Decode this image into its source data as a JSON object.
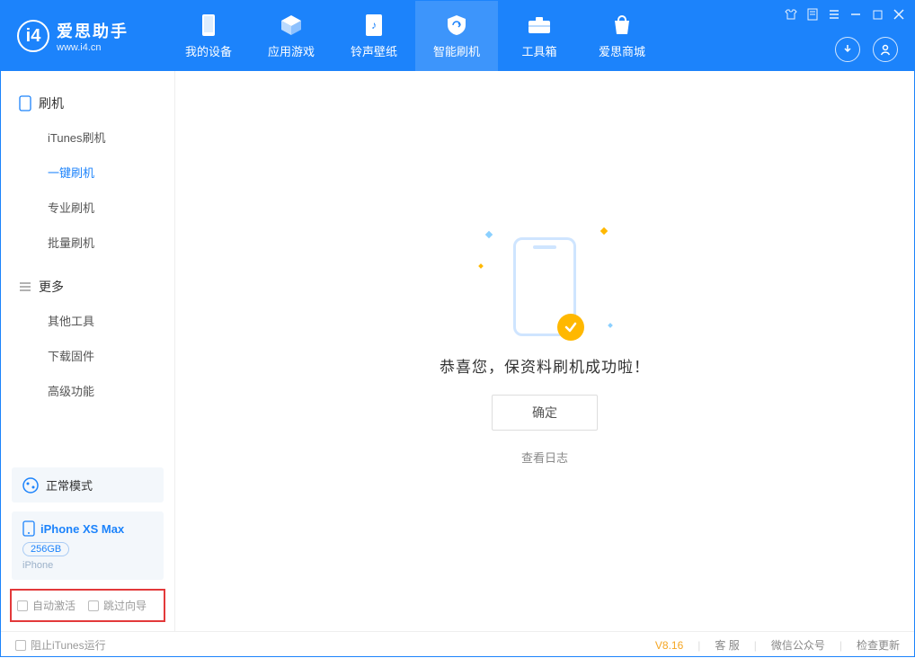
{
  "app": {
    "name_cn": "爱思助手",
    "url": "www.i4.cn"
  },
  "nav": {
    "tabs": [
      {
        "label": "我的设备"
      },
      {
        "label": "应用游戏"
      },
      {
        "label": "铃声壁纸"
      },
      {
        "label": "智能刷机"
      },
      {
        "label": "工具箱"
      },
      {
        "label": "爱思商城"
      }
    ]
  },
  "sidebar": {
    "section1_title": "刷机",
    "section1_items": [
      "iTunes刷机",
      "一键刷机",
      "专业刷机",
      "批量刷机"
    ],
    "section2_title": "更多",
    "section2_items": [
      "其他工具",
      "下载固件",
      "高级功能"
    ],
    "mode_label": "正常模式",
    "device": {
      "name": "iPhone XS Max",
      "capacity": "256GB",
      "type": "iPhone"
    },
    "options": {
      "auto_activate": "自动激活",
      "skip_guide": "跳过向导"
    }
  },
  "main": {
    "success_message": "恭喜您，保资料刷机成功啦！",
    "confirm_label": "确定",
    "view_log_label": "查看日志"
  },
  "status": {
    "block_itunes": "阻止iTunes运行",
    "version": "V8.16",
    "customer_service": "客 服",
    "wechat_public": "微信公众号",
    "check_update": "检查更新"
  }
}
